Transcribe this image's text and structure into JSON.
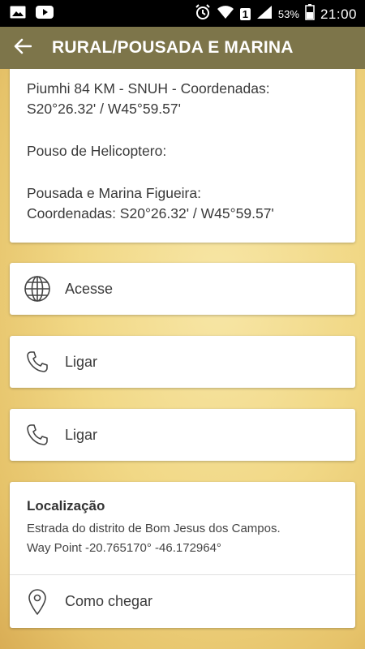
{
  "status_bar": {
    "sim_indicator": "1",
    "battery": "53%",
    "time": "21:00",
    "icons": [
      "image-icon",
      "youtube-icon",
      "alarm-icon",
      "wifi-icon",
      "signal-icon",
      "battery-icon"
    ]
  },
  "appbar": {
    "title": "RURAL/POUSADA E MARINA",
    "background": "#7d754a"
  },
  "info": {
    "lines": [
      "Piumhi 84 KM - SNUH - Coordenadas:",
      "S20°26.32' / W45°59.57'",
      "Pouso de Helicoptero:",
      "Pousada e Marina Figueira:",
      "Coordenadas: S20°26.32' / W45°59.57'"
    ]
  },
  "actions": {
    "website": {
      "label": "Acesse",
      "icon": "globe-icon"
    },
    "phone1": {
      "label": "Ligar",
      "icon": "phone-icon"
    },
    "phone2": {
      "label": "Ligar",
      "icon": "phone-icon"
    }
  },
  "location": {
    "title": "Localização",
    "line1": "Estrada do distrito de Bom Jesus dos Campos.",
    "line2": "Way Point -20.765170° -46.172964°",
    "directions_label": "Como chegar",
    "directions_icon": "map-pin-icon"
  }
}
